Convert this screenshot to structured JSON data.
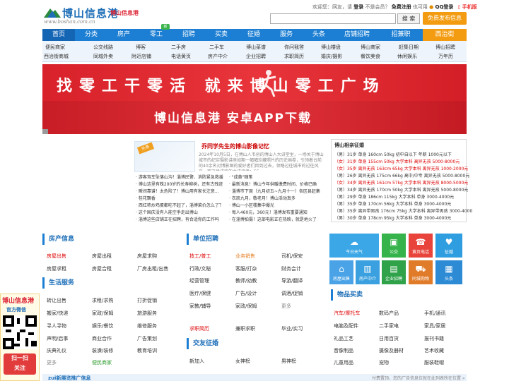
{
  "header": {
    "logo_title": "博山信息港",
    "logo_sub": "博山信息港",
    "logo_url": "www.boshan.com.cn",
    "user_line_prefix": "欢迎您：网友，请",
    "login": "登录",
    "not_member": "不是会员？",
    "register": "免费注册",
    "or_use": "也可用",
    "qq_login": "QQ登录",
    "mobile": "手机版",
    "search_placeholder": "",
    "search_button": "搜 索",
    "post_button": "免费发布信息"
  },
  "nav": {
    "items": [
      "首页",
      "分类",
      "房产",
      "零工",
      "招聘",
      "买卖",
      "征婚",
      "服务",
      "头条",
      "店铺招聘",
      "招兼职",
      "西治街"
    ],
    "badge": "新"
  },
  "sub_nav": {
    "row1": [
      "便民商家",
      "公交线路",
      "博客",
      "二手房",
      "二手车",
      "博山菜谱",
      "你问我答",
      "博山楼盘",
      "博山商家",
      "赶集日期",
      "博山招聘"
    ],
    "row2": [
      "西治街商城",
      "同城外卖",
      "附近店铺",
      "电话黄页",
      "房产中介",
      "企业招聘",
      "求职简历",
      "婚庆/摄影",
      "餐饮美食",
      "休闲娱乐",
      "万年历"
    ]
  },
  "banners": {
    "banner1": "找零工干零活 就来博山零工广场",
    "banner2": "博山信息港 安卓APP下载"
  },
  "featured": {
    "badge": "头条",
    "title": "乔同学先生的博山影像记忆",
    "body": "2024年10月5日，在博山人韦创的博山人大讲堂里，一场关于博山城市的纪实摄影讲座如期一幅幅珍藏照片的历史画卷，引领着台前的40余名对博影图的爱好者们回到过去，领略过往城市的过往风采，而这场讲座的主讲读者：55..."
  },
  "news": [
    "· 游客驾车坠落山沟！淄博民警、消防紧急救援",
    "· \"成黄\"随笔",
    "· 博山这里有株200岁的长寿柳树，还有古残迹",
    "· 最新消息！博山今年供暖缴费时间、价格已确",
    "· 瞬间靠谱！太危险了！博山用有家长注意...",
    "· 淄博市下周（九月初五~九月十一）各区县赶集",
    "· 桂花飘香",
    "· 衣凯九月，敬老月！博山活动真多",
    "· 西红柿炒鸡蛋都吃不起了，淄博菜价怎么了？",
    "· 博山一小区楼集中爆光",
    "· 这个国庆没有人能空手走出博山",
    "· 每人460元，360元！淄博发布重要通知",
    "· 淄博这些店铺正在招聘，有合适你的工作吗",
    "· 在淄博拍摄！这部电影正在热映，就是地火了"
  ],
  "jobs": {
    "title": "博山相亲征婚",
    "items": [
      {
        "text": "（男）31岁 单身 160cm 50kg 初中自以下 年薪 1000元以下",
        "color": "#333333"
      },
      {
        "text": "（女）31岁 单身 155cm 50kg 大学本科 高异无孩 5000-8000元",
        "color": "#dd0000"
      },
      {
        "text": "（女）35岁 离异无孩 163cm 65kg 大学本科 离异无孩 1000-2000元",
        "color": "#dd0000"
      },
      {
        "text": "（男）26岁 离异无孩 175cm 66kg 高中/中专 离异无孩 5000-8000元",
        "color": "#333333"
      },
      {
        "text": "（女）34岁 离异无孩 161cm 57kg 大学本科 离异无孩 8000-5000元",
        "color": "#dd0000"
      },
      {
        "text": "（男）34岁 离异无孩 170cm 50kg 大学本科 离异无孩 5000-8000元",
        "color": "#333333"
      },
      {
        "text": "（男）29岁 单身 186cm 115kg 大学本科 单身 3000-4000元",
        "color": "#333333"
      },
      {
        "text": "（男）35岁 单身 170cm 56kg 大学本科 单身 3000-4000元",
        "color": "#333333"
      },
      {
        "text": "（男）35岁 离异带男孩 176cm 75kg 大学本科 离异带男孩 3000-4000",
        "color": "#333333"
      },
      {
        "text": "（男）30岁 单身 178cm 95kg 大学本科 单身 3000-4000元",
        "color": "#333333"
      }
    ]
  },
  "sections": {
    "house": {
      "title": "房产信息",
      "items": [
        "房屋出售",
        "房屋出租",
        "房屋求购",
        "房屋求租",
        "房屋合租",
        "厂房出租/出售"
      ]
    },
    "life": {
      "title": "生活服务",
      "items": [
        "转让出售",
        "求租/求购",
        "打折促销",
        "搬家/快递",
        "家政/保姆",
        "旅游服务",
        "寻人寻物",
        "娱乐/餐饮",
        "维修服务",
        "声明/启事",
        "商业合作",
        "广告策划",
        "庆典礼仪",
        "装潢/装修",
        "教育培训",
        "更多",
        "便民商家"
      ]
    },
    "jobs_sec": {
      "title": "单位招聘",
      "items": [
        "技工/普工",
        "业务销售",
        "司机/保安",
        "行政/文秘",
        "客服/打杂",
        "财务会计",
        "经营管理",
        "教师/幼教",
        "导游/翻译",
        "医疗/保健",
        "广告/设计",
        "调酒/促销",
        "家教/辅导",
        "家政/保姆",
        "更多",
        "求职简历",
        "兼职求职",
        "毕业/实习"
      ]
    },
    "dating": {
      "title": "交友征婚",
      "items": [
        "新加入",
        "女神榜",
        "男神榜"
      ]
    },
    "goods": {
      "title": "物品买卖",
      "items": [
        "汽车/摩托车",
        "数码产品",
        "手机/通讯",
        "电脑及配件",
        "二手家电",
        "家具/家居",
        "礼品工艺",
        "日用百货",
        "报刊书籍",
        "音像制品",
        "摄像及器材",
        "艺术收藏",
        "儿童用品",
        "宠物",
        "服装鞋帽"
      ]
    }
  },
  "tiles": [
    {
      "label": "今日天气",
      "icon": "cloud-icon",
      "color": "#3ba7e6"
    },
    {
      "label": "公交",
      "icon": "bus-icon",
      "color": "#36b34a"
    },
    {
      "label": "黄页电话",
      "icon": "phone-icon",
      "color": "#e8443b"
    },
    {
      "label": "征婚",
      "icon": "heart-icon",
      "color": "#2f9ee0"
    },
    {
      "label": "房屋出售",
      "icon": "house-icon",
      "color": "#4aa3e6"
    },
    {
      "label": "房产中介",
      "icon": "building-icon",
      "color": "#3aa0df"
    },
    {
      "label": "企业招聘",
      "icon": "briefcase-icon",
      "color": "#30a24a"
    },
    {
      "label": "同城购物",
      "icon": "cart-icon",
      "color": "#e07b2a"
    },
    {
      "label": "头条",
      "icon": "news-icon",
      "color": "#2d8bd6"
    }
  ],
  "qr": {
    "title": "博山信息港",
    "sub": "官方微信",
    "cta": "扫一扫\n关注"
  },
  "footer": {
    "left": "zui新展览推广信息",
    "right": "付费置顶，您的广告信息位就在此列表所在位置 »"
  }
}
